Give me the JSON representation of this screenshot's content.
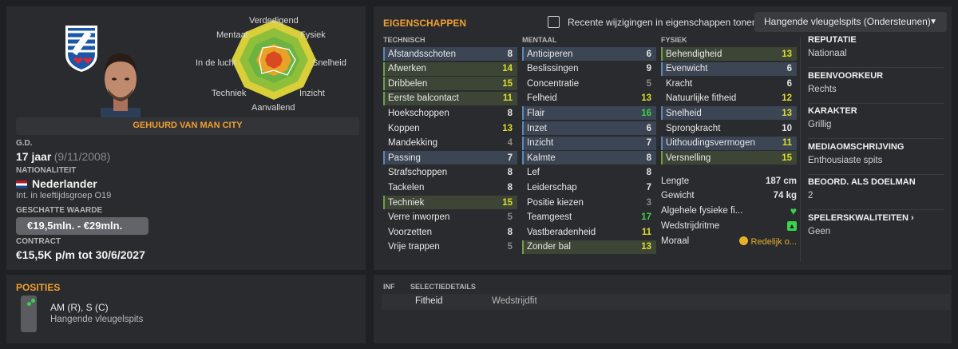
{
  "profile": {
    "hired_banner": "GEHUURD VAN MAN CITY",
    "dob_label": "G.D.",
    "age": "17 jaar",
    "dob": "(9/11/2008)",
    "nationality_label": "NATIONALITEIT",
    "nationality": "Nederlander",
    "youth_international": "Int. in leeftijdsgroep O19",
    "value_label": "GESCHATTE WAARDE",
    "value": "€19,5mln. - €29mln.",
    "contract_label": "CONTRACT",
    "contract": "€15,5K p/m tot 30/6/2027",
    "club_logo_text": "sc Heerenveen"
  },
  "radar": {
    "labels": [
      "Verdedigend",
      "Fysiek",
      "Snelheid",
      "Inzicht",
      "Aanvallend",
      "Techniek",
      "In de lucht",
      "Mentaal"
    ]
  },
  "attributes": {
    "title": "EIGENSCHAPPEN",
    "show_recent_label": "Recente wijzigingen in eigenschappen tonen",
    "role_select": "Hangende vleugelspits (Ondersteunen)",
    "columns": [
      {
        "header": "TECHNISCH",
        "rows": [
          {
            "name": "Afstandsschoten",
            "value": "8",
            "hl": "blue"
          },
          {
            "name": "Afwerken",
            "value": "14",
            "hl": "green"
          },
          {
            "name": "Dribbelen",
            "value": "15",
            "hl": "green"
          },
          {
            "name": "Eerste balcontact",
            "value": "11",
            "hl": "green"
          },
          {
            "name": "Hoekschoppen",
            "value": "8",
            "hl": ""
          },
          {
            "name": "Koppen",
            "value": "13",
            "hl": ""
          },
          {
            "name": "Mandekking",
            "value": "4",
            "hl": ""
          },
          {
            "name": "Passing",
            "value": "7",
            "hl": "blue"
          },
          {
            "name": "Strafschoppen",
            "value": "8",
            "hl": ""
          },
          {
            "name": "Tackelen",
            "value": "8",
            "hl": ""
          },
          {
            "name": "Techniek",
            "value": "15",
            "hl": "green"
          },
          {
            "name": "Verre inworpen",
            "value": "5",
            "hl": ""
          },
          {
            "name": "Voorzetten",
            "value": "8",
            "hl": ""
          },
          {
            "name": "Vrije trappen",
            "value": "5",
            "hl": ""
          }
        ]
      },
      {
        "header": "MENTAAL",
        "rows": [
          {
            "name": "Anticiperen",
            "value": "6",
            "hl": "blue"
          },
          {
            "name": "Beslissingen",
            "value": "9",
            "hl": ""
          },
          {
            "name": "Concentratie",
            "value": "5",
            "hl": ""
          },
          {
            "name": "Felheid",
            "value": "13",
            "hl": ""
          },
          {
            "name": "Flair",
            "value": "16",
            "hl": "blue"
          },
          {
            "name": "Inzet",
            "value": "6",
            "hl": "blue"
          },
          {
            "name": "Inzicht",
            "value": "7",
            "hl": "blue"
          },
          {
            "name": "Kalmte",
            "value": "8",
            "hl": "blue"
          },
          {
            "name": "Lef",
            "value": "8",
            "hl": ""
          },
          {
            "name": "Leiderschap",
            "value": "7",
            "hl": ""
          },
          {
            "name": "Positie kiezen",
            "value": "3",
            "hl": ""
          },
          {
            "name": "Teamgeest",
            "value": "17",
            "hl": ""
          },
          {
            "name": "Vastberadenheid",
            "value": "11",
            "hl": ""
          },
          {
            "name": "Zonder bal",
            "value": "13",
            "hl": "green"
          }
        ]
      },
      {
        "header": "FYSIEK",
        "rows": [
          {
            "name": "Behendigheid",
            "value": "13",
            "hl": "green"
          },
          {
            "name": "Evenwicht",
            "value": "6",
            "hl": "blue"
          },
          {
            "name": "Kracht",
            "value": "6",
            "hl": ""
          },
          {
            "name": "Natuurlijke fitheid",
            "value": "12",
            "hl": ""
          },
          {
            "name": "Snelheid",
            "value": "13",
            "hl": "blue"
          },
          {
            "name": "Sprongkracht",
            "value": "10",
            "hl": ""
          },
          {
            "name": "Uithoudingsvermogen",
            "value": "11",
            "hl": "blue"
          },
          {
            "name": "Versnelling",
            "value": "15",
            "hl": "green"
          }
        ]
      }
    ],
    "physical": {
      "length_label": "Lengte",
      "length": "187 cm",
      "weight_label": "Gewicht",
      "weight": "74 kg",
      "fitness_label": "Algehele fysieke fi...",
      "match_label": "Wedstrijdritme",
      "morale_label": "Moraal",
      "morale": "Redelijk o..."
    }
  },
  "side_info": [
    {
      "h": "REPUTATIE",
      "t": "Nationaal"
    },
    {
      "h": "BEENVOORKEUR",
      "t": "Rechts"
    },
    {
      "h": "KARAKTER",
      "t": "Grillig"
    },
    {
      "h": "MEDIAOMSCHRIJVING",
      "t": "Enthousiaste spits"
    },
    {
      "h": "BEOORD. ALS DOELMAN",
      "t": "2"
    },
    {
      "h": "SPELERSKWALITEITEN ›",
      "t": "Geen"
    }
  ],
  "positions": {
    "title": "POSITIES",
    "codes": "AM (R), S (C)",
    "role": "Hangende vleugelspits"
  },
  "selection": {
    "col1": "INF",
    "col2": "SELECTIEDETAILS",
    "item_label": "Fitheid",
    "item_value": "Wedstrijdfit"
  },
  "colors": {
    "accent": "#f0a030",
    "green_hl": "#6fa047",
    "blue_hl": "#5b87b8",
    "good": "#3cd24c",
    "yellow": "#dede2c"
  }
}
